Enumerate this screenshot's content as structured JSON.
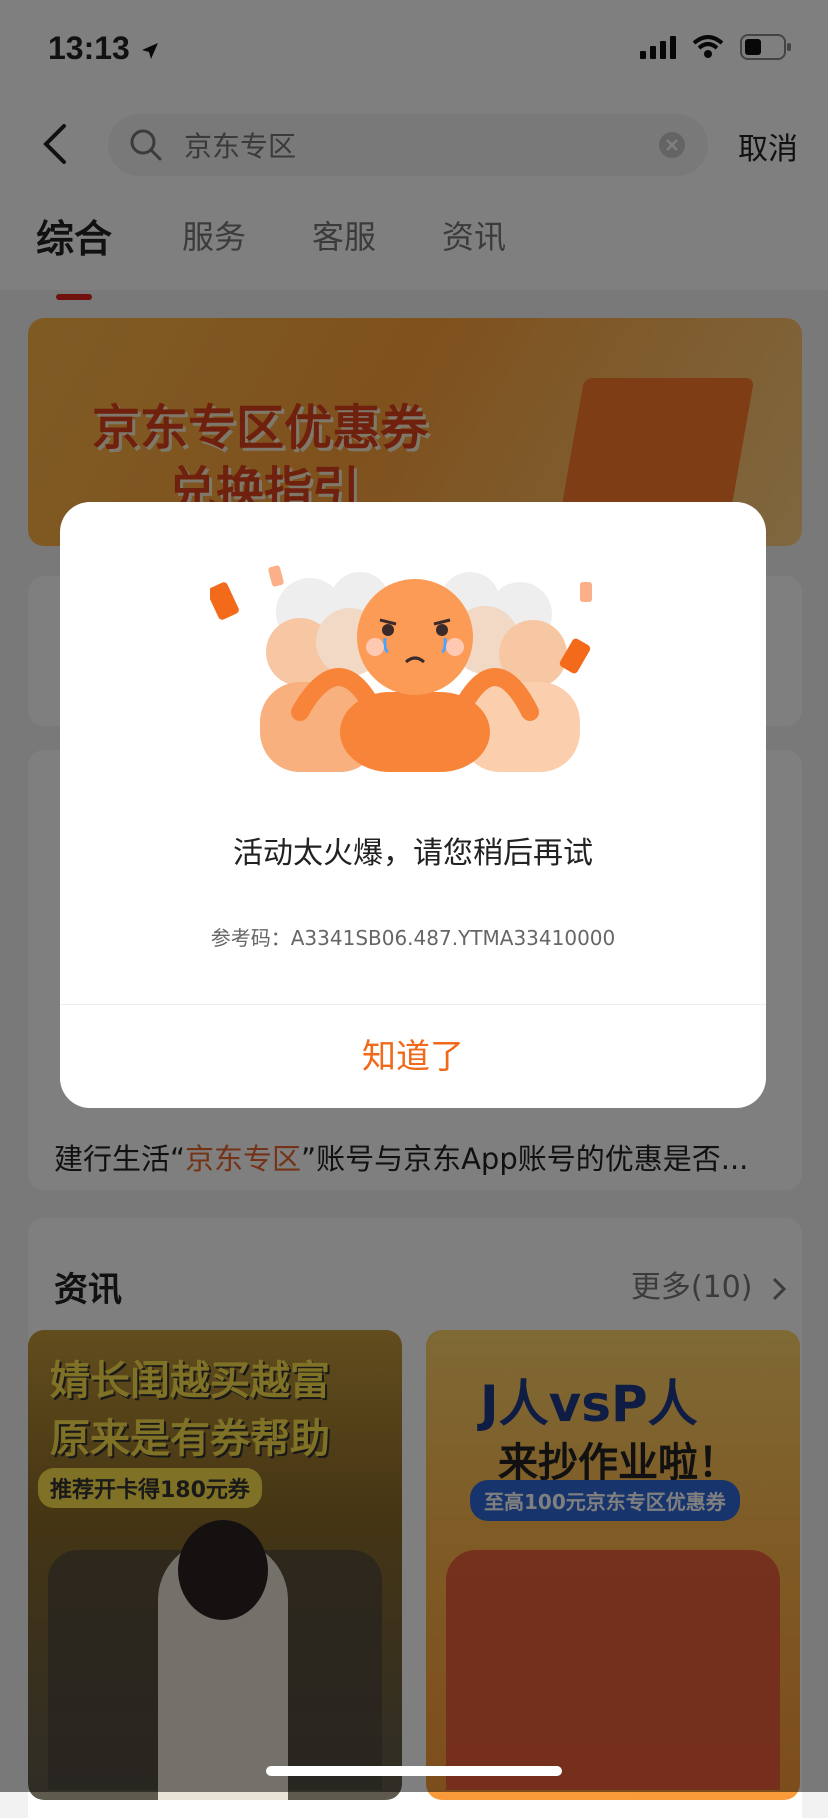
{
  "status_bar": {
    "time": "13:13"
  },
  "search": {
    "query": "京东专区",
    "cancel_label": "取消"
  },
  "tabs": [
    {
      "label": "综合",
      "active": true
    },
    {
      "label": "服务",
      "active": false
    },
    {
      "label": "客服",
      "active": false
    },
    {
      "label": "资讯",
      "active": false
    }
  ],
  "banner": {
    "line1": "京东专区优惠券",
    "line2": "兑换指引"
  },
  "qa": {
    "text_before": "建行生活“",
    "text_highlight": "京东专区",
    "text_after": "”账号与京东App账号的优惠是否..."
  },
  "news": {
    "title": "资讯",
    "more_label": "更多(10)",
    "items": [
      {
        "line1": "婧长闺越买越富",
        "line2": "原来是有券帮助",
        "tag": "推荐开卡得180元券"
      },
      {
        "line1": "J人vsP人",
        "line2": "来抄作业啦！",
        "tag": "至高100元京东专区优惠券"
      }
    ]
  },
  "modal": {
    "message": "活动太火爆，请您稍后再试",
    "reference_label": "参考码：",
    "reference_code": "A3341SB06.487.YTMA33410000",
    "button_label": "知道了"
  },
  "colors": {
    "accent": "#e2231a",
    "button_text": "#f06a1a",
    "highlight": "#e8642c"
  },
  "icons": [
    "location-arrow-icon",
    "signal-icon",
    "wifi-icon",
    "battery-icon",
    "back-icon",
    "search-icon",
    "clear-icon",
    "chevron-right-icon",
    "crowd-illustration"
  ]
}
